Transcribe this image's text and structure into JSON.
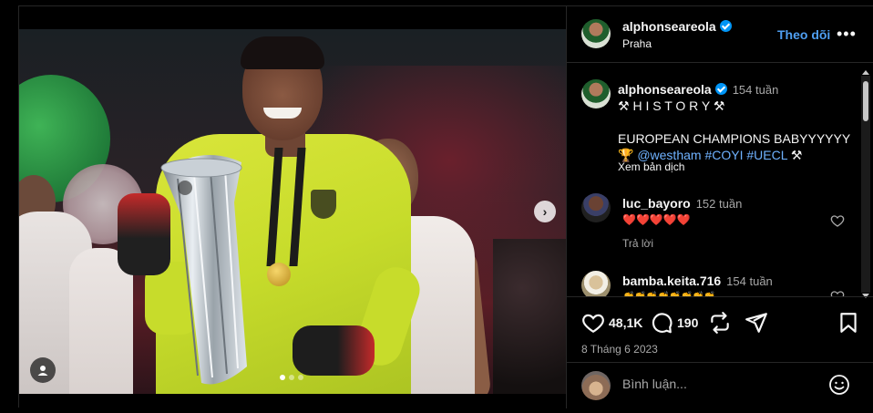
{
  "post": {
    "username": "alphonseareola",
    "location": "Praha",
    "follow_label": "Theo dõi",
    "more_label": "•••",
    "image_alt": "alphonseareola",
    "carousel": {
      "total": 3,
      "active": 1
    }
  },
  "caption": {
    "username": "alphonseareola",
    "age": "154 tuần",
    "line1": "⚒ H I S T O R Y ⚒",
    "line2": "EUROPEAN CHAMPIONS BABYYYYYY",
    "line3_prefix": "🏆",
    "mentions": "@westham #COYI #UECL",
    "line3_suffix": "⚒",
    "see_translation": "Xem bản dịch"
  },
  "comments": [
    {
      "username": "luc_bayoro",
      "age": "152 tuần",
      "text": "❤️❤️❤️❤️❤️",
      "reply_label": "Trả lời"
    },
    {
      "username": "bamba.keita.716",
      "age": "154 tuần",
      "text": "👏👏👏👏👏👏👏👏"
    }
  ],
  "actions": {
    "likes": "48,1K",
    "comments": "190",
    "date": "8 Tháng 6 2023"
  },
  "comment_box": {
    "placeholder": "Bình luận..."
  },
  "colors": {
    "background": "#000000",
    "link": "#4f9ff2",
    "verified": "#0095f6",
    "hashtag": "#6fb2ff",
    "muted": "#a8a8a8",
    "heart": "#ed4956"
  }
}
